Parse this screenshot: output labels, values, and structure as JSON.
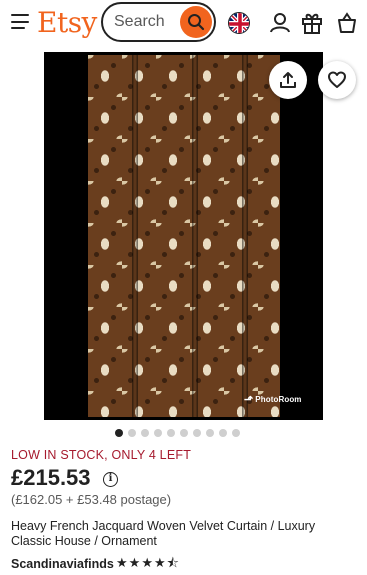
{
  "header": {
    "logo": "Etsy",
    "search_placeholder": "Search",
    "brand_color": "#F1641E",
    "icons": [
      "hamburger-menu-icon",
      "search-icon",
      "uk-flag-icon",
      "profile-icon",
      "gift-icon",
      "shopping-bag-icon"
    ]
  },
  "gallery": {
    "watermark": "PhotoRoom",
    "image_count": 10,
    "active_index": 0,
    "icons": [
      "share-icon",
      "heart-icon"
    ]
  },
  "product": {
    "stock_status": "LOW IN STOCK, ONLY 4 LEFT",
    "price": "£215.53",
    "price_breakdown": "(£162.05 + £53.48 postage)",
    "title": "Heavy French Jacquard Woven Velvet Curtain / Luxury Classic House / Ornament",
    "shop_name": "Scandinaviafinds",
    "rating": 4.5,
    "stock_color": "#A61A2E"
  }
}
